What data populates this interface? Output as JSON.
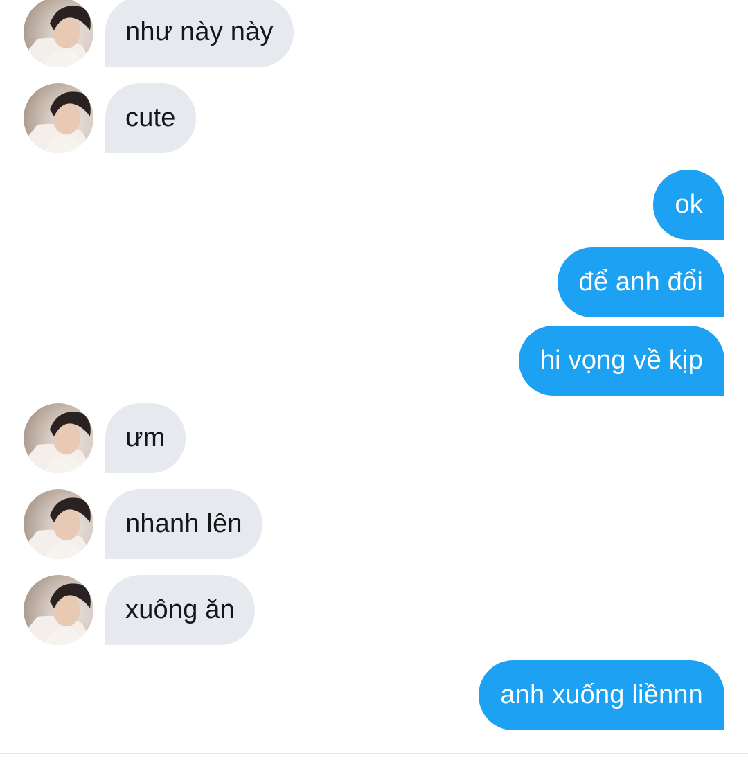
{
  "conversation": {
    "messages": [
      {
        "direction": "incoming",
        "text": "như này này",
        "avatar": "contact-avatar"
      },
      {
        "direction": "incoming",
        "text": "cute",
        "avatar": "contact-avatar"
      },
      {
        "direction": "outgoing",
        "text": "ok"
      },
      {
        "direction": "outgoing",
        "text": "để anh đổi"
      },
      {
        "direction": "outgoing",
        "text": "hi vọng về kịp"
      },
      {
        "direction": "incoming",
        "text": "ưm",
        "avatar": "contact-avatar"
      },
      {
        "direction": "incoming",
        "text": "nhanh lên",
        "avatar": "contact-avatar"
      },
      {
        "direction": "incoming",
        "text": "xuông ăn",
        "avatar": "contact-avatar"
      },
      {
        "direction": "outgoing",
        "text": "anh xuống liềnnn"
      }
    ]
  },
  "colors": {
    "incoming_bubble": "#e6eaef",
    "incoming_text": "#14171a",
    "outgoing_bubble": "#1da1f2",
    "outgoing_text": "#ffffff",
    "background": "#ffffff"
  }
}
